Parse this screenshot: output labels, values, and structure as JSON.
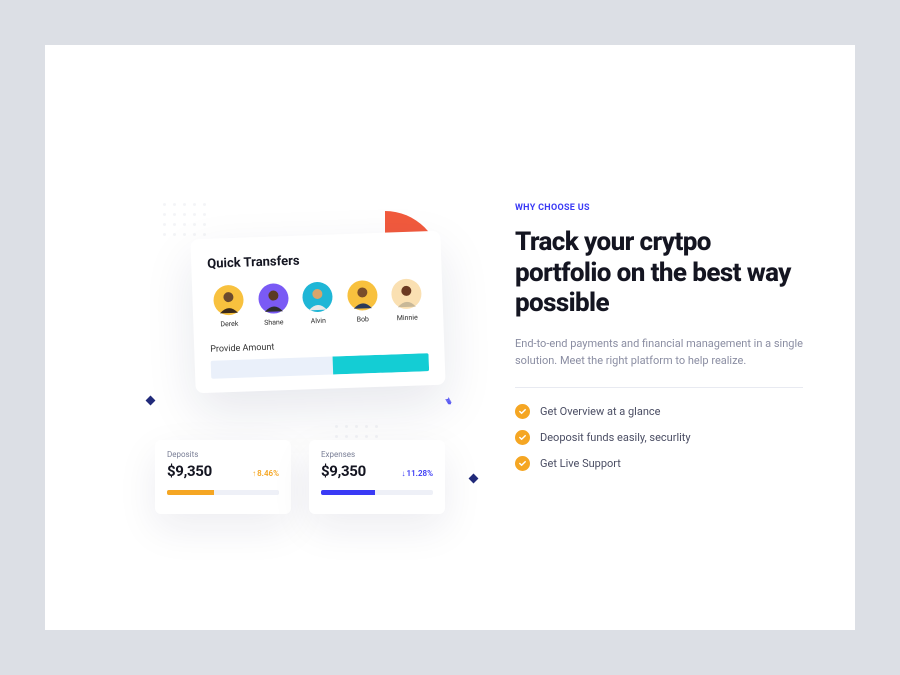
{
  "transfers": {
    "title": "Quick Transfers",
    "provideLabel": "Provide Amount",
    "people": [
      {
        "name": "Derek",
        "bg": "#f8c13e"
      },
      {
        "name": "Shane",
        "bg": "#7a5af5"
      },
      {
        "name": "Alvin",
        "bg": "#1fb6d6"
      },
      {
        "name": "Bob",
        "bg": "#f8c13e"
      },
      {
        "name": "Minnie",
        "bg": "#fae0b2"
      }
    ]
  },
  "stats": {
    "deposits": {
      "label": "Deposits",
      "amount": "$9,350",
      "change": "8.46%",
      "arrow": "↑"
    },
    "expenses": {
      "label": "Expenses",
      "amount": "$9,350",
      "change": "11.28%",
      "arrow": "↓"
    }
  },
  "copy": {
    "eyebrow": "WHY CHOOSE US",
    "headline": "Track your crytpo portfolio on the best way possible",
    "desc": "End-to-end payments and financial management in a single solution. Meet the right platform to help realize."
  },
  "features": [
    "Get Overview at a glance",
    "Deoposit funds easily, securlity",
    "Get Live Support"
  ]
}
